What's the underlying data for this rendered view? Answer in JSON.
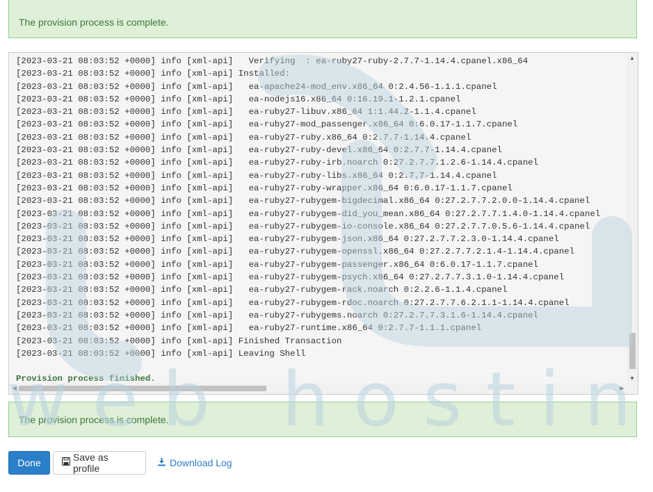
{
  "alerts": {
    "top_message": "The provision process is complete.",
    "bottom_message": "The provision process is complete."
  },
  "log": {
    "lines": [
      "[2023-03-21 08:03:52 +0000] info [xml-api]   Verifying  : ea-ruby27-ruby-2.7.7-1.14.4.cpanel.x86_64",
      "[2023-03-21 08:03:52 +0000] info [xml-api] Installed:",
      "[2023-03-21 08:03:52 +0000] info [xml-api]   ea-apache24-mod_env.x86_64 0:2.4.56-1.1.1.cpanel",
      "[2023-03-21 08:03:52 +0000] info [xml-api]   ea-nodejs16.x86_64 0:16.19.1-1.2.1.cpanel",
      "[2023-03-21 08:03:52 +0000] info [xml-api]   ea-ruby27-libuv.x86_64 1:1.44.2-1.1.4.cpanel",
      "[2023-03-21 08:03:52 +0000] info [xml-api]   ea-ruby27-mod_passenger.x86_64 0:6.0.17-1.1.7.cpanel",
      "[2023-03-21 08:03:52 +0000] info [xml-api]   ea-ruby27-ruby.x86_64 0:2.7.7-1.14.4.cpanel",
      "[2023-03-21 08:03:52 +0000] info [xml-api]   ea-ruby27-ruby-devel.x86_64 0:2.7.7-1.14.4.cpanel",
      "[2023-03-21 08:03:52 +0000] info [xml-api]   ea-ruby27-ruby-irb.noarch 0:27.2.7.7.1.2.6-1.14.4.cpanel",
      "[2023-03-21 08:03:52 +0000] info [xml-api]   ea-ruby27-ruby-libs.x86_64 0:2.7.7-1.14.4.cpanel",
      "[2023-03-21 08:03:52 +0000] info [xml-api]   ea-ruby27-ruby-wrapper.x86_64 0:6.0.17-1.1.7.cpanel",
      "[2023-03-21 08:03:52 +0000] info [xml-api]   ea-ruby27-rubygem-bigdecimal.x86_64 0:27.2.7.7.2.0.0-1.14.4.cpanel",
      "[2023-03-21 08:03:52 +0000] info [xml-api]   ea-ruby27-rubygem-did_you_mean.x86_64 0:27.2.7.7.1.4.0-1.14.4.cpanel",
      "[2023-03-21 08:03:52 +0000] info [xml-api]   ea-ruby27-rubygem-io-console.x86_64 0:27.2.7.7.0.5.6-1.14.4.cpanel",
      "[2023-03-21 08:03:52 +0000] info [xml-api]   ea-ruby27-rubygem-json.x86_64 0:27.2.7.7.2.3.0-1.14.4.cpanel",
      "[2023-03-21 08:03:52 +0000] info [xml-api]   ea-ruby27-rubygem-openssl.x86_64 0:27.2.7.7.2.1.4-1.14.4.cpanel",
      "[2023-03-21 08:03:52 +0000] info [xml-api]   ea-ruby27-rubygem-passenger.x86_64 0:6.0.17-1.1.7.cpanel",
      "[2023-03-21 08:03:52 +0000] info [xml-api]   ea-ruby27-rubygem-psych.x86_64 0:27.2.7.7.3.1.0-1.14.4.cpanel",
      "[2023-03-21 08:03:52 +0000] info [xml-api]   ea-ruby27-rubygem-rack.noarch 0:2.2.6-1.1.4.cpanel",
      "[2023-03-21 08:03:52 +0000] info [xml-api]   ea-ruby27-rubygem-rdoc.noarch 0:27.2.7.7.6.2.1.1-1.14.4.cpanel",
      "[2023-03-21 08:03:52 +0000] info [xml-api]   ea-ruby27-rubygems.noarch 0:27.2.7.7.3.1.6-1.14.4.cpanel",
      "[2023-03-21 08:03:52 +0000] info [xml-api]   ea-ruby27-runtime.x86_64 0:2.7.7-1.1.1.cpanel",
      "[2023-03-21 08:03:52 +0000] info [xml-api] Finished Transaction",
      "[2023-03-21 08:03:52 +0000] info [xml-api] Leaving Shell"
    ],
    "finished_text": "Provision process finished.",
    "scroll_up_icon": "caret-up-icon",
    "scroll_down_icon": "caret-down-icon",
    "scroll_left_icon": "caret-left-icon",
    "scroll_right_icon": "caret-right-icon"
  },
  "watermark": {
    "text": "w e b   h o s t i n g",
    "color": "#b8d2e0"
  },
  "actions": {
    "done_label": "Done",
    "save_profile_label": "Save as profile",
    "save_profile_icon": "floppy-disk-icon",
    "download_log_label": "Download Log",
    "download_icon": "download-icon"
  },
  "colors": {
    "success_bg": "#dff0d8",
    "success_border": "#8fd18f",
    "success_text": "#3c763d",
    "primary": "#2a7fc8"
  }
}
